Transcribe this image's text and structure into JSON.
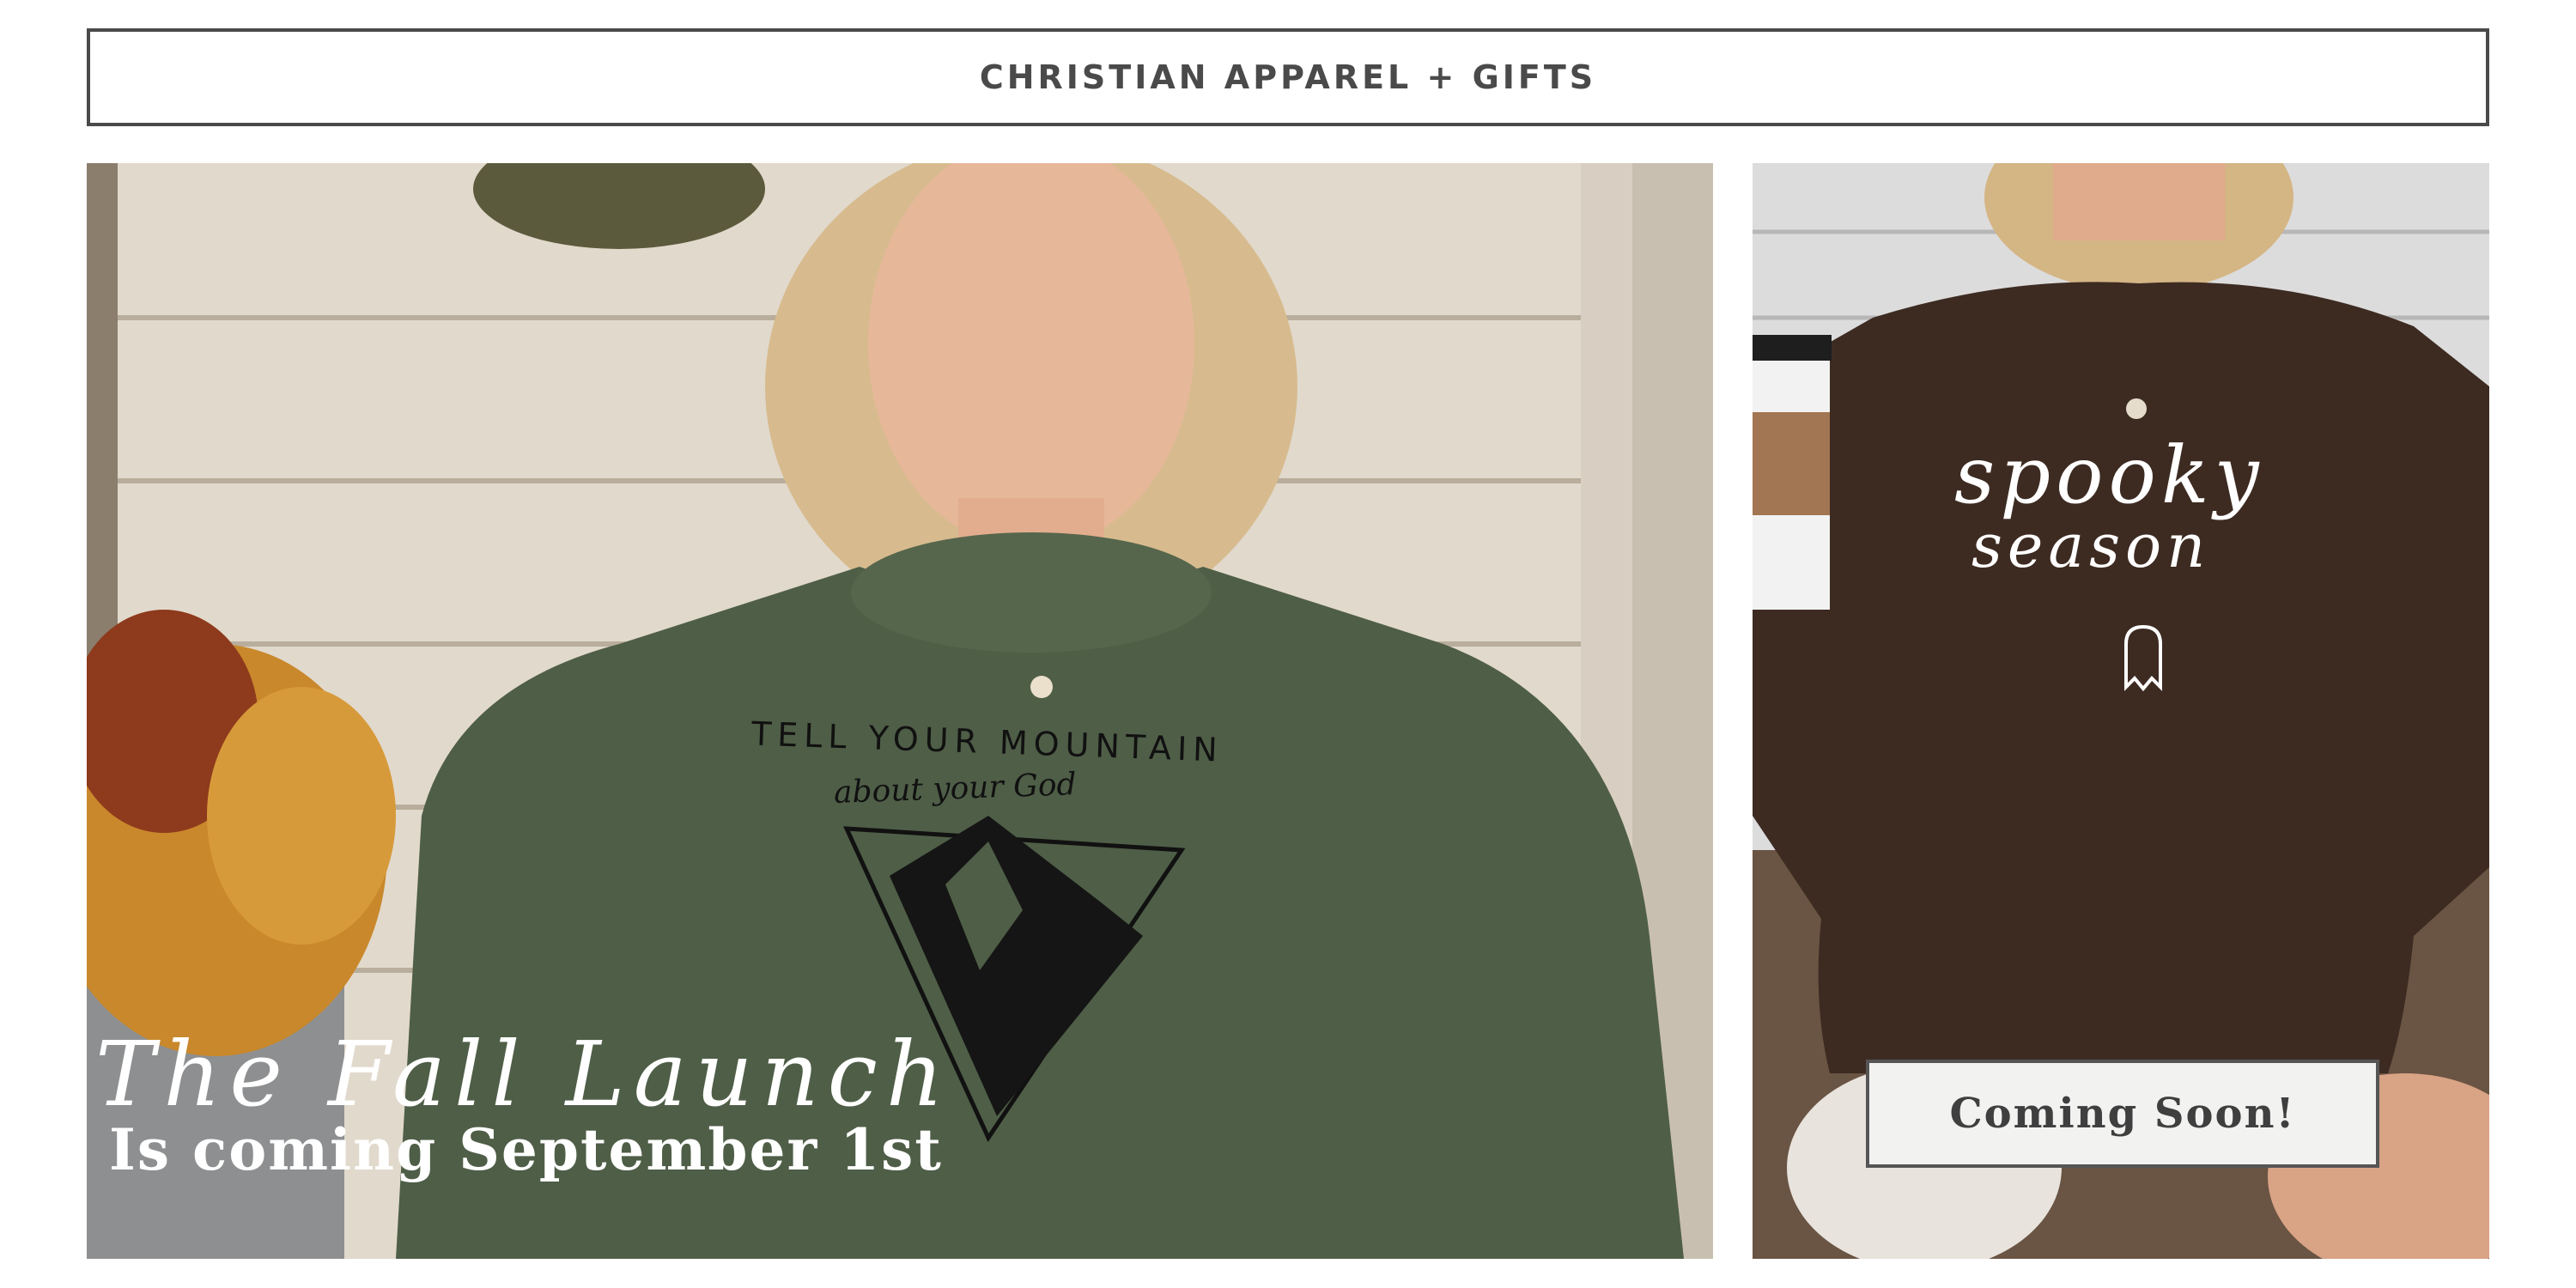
{
  "banner": {
    "label": "CHRISTIAN APPAREL + GIFTS"
  },
  "hero": {
    "shirt_line1": "TELL YOUR MOUNTAIN",
    "shirt_line2": "about your God",
    "script_title": "The Fall Launch",
    "subtitle": "Is coming September 1st"
  },
  "side": {
    "shirt_line1": "spooky",
    "shirt_line2": "season",
    "badge": "Coming Soon!"
  },
  "colors": {
    "border": "#4a4a4a",
    "green_sweatshirt": "#4f5e47",
    "brown_sweatshirt": "#3d2b22",
    "wood_wall": "#e4ddd1"
  }
}
